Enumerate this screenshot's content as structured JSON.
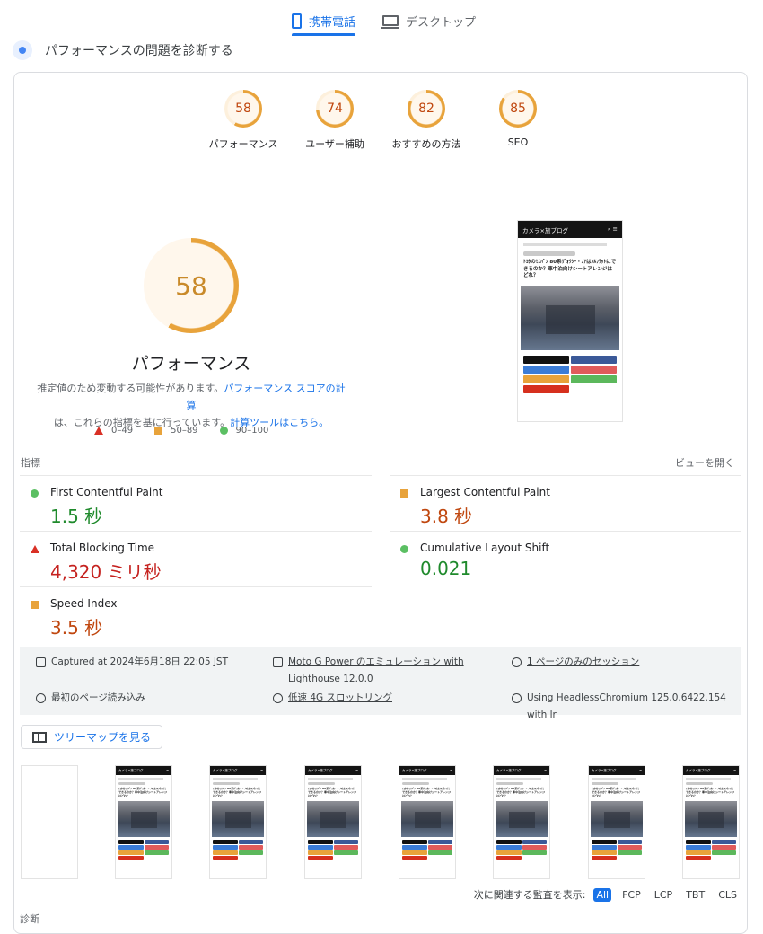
{
  "tabs": {
    "mobile": "携帯電話",
    "desktop": "デスクトップ"
  },
  "heading": "パフォーマンスの問題を診断する",
  "categories": [
    {
      "score": "58",
      "label": "パフォーマンス",
      "fill_pct": 58
    },
    {
      "score": "74",
      "label": "ユーザー補助",
      "fill_pct": 74
    },
    {
      "score": "82",
      "label": "おすすめの方法",
      "fill_pct": 82
    },
    {
      "score": "85",
      "label": "SEO",
      "fill_pct": 85
    }
  ],
  "performance": {
    "score": "58",
    "title": "パフォーマンス",
    "estimate_text_1": "推定値のため変動する可能性があります。",
    "estimate_link_1": "パフォーマンス スコアの計算",
    "estimate_text_2": "は、これらの指標を基に行っています。",
    "estimate_link_2": "計算ツールはこちら。"
  },
  "legend": {
    "fail": "0–49",
    "average": "50–89",
    "pass": "90–100"
  },
  "screenshot": {
    "site_title": "カメラ×旅ブログ",
    "article_title": "ﾄﾖﾀのﾐﾆﾊﾞﾝ 80系ｳﾞｫｸｼｰ・ﾉｱはﾌﾙﾌﾗｯﾄにできるのか？車中泊向けシートアレンジはどれ？",
    "share_labels": [
      "Post",
      "Share",
      "Hatena",
      "Pocket",
      "LINE",
      "Feedly",
      "ｺﾋﾟｰ"
    ]
  },
  "metrics": {
    "header": "指標",
    "expand": "ビューを開く",
    "fcp": {
      "name": "First Contentful Paint",
      "value": "1.5 秒"
    },
    "lcp": {
      "name": "Largest Contentful Paint",
      "value": "3.8 秒"
    },
    "tbt": {
      "name": "Total Blocking Time",
      "value": "4,320 ミリ秒"
    },
    "cls": {
      "name": "Cumulative Layout Shift",
      "value": "0.021"
    },
    "si": {
      "name": "Speed Index",
      "value": "3.5 秒"
    }
  },
  "info": {
    "captured": "Captured at 2024年6月18日 22:05 JST",
    "device_1": "Moto G Power のエミュレーション with",
    "device_2": "Lighthouse 12.0.0",
    "session": "1 ページのみのセッション",
    "load": "最初のページ読み込み",
    "throttle": "低速 4G スロットリング",
    "browser": "Using HeadlessChromium 125.0.6422.154 with lr"
  },
  "treemap_button": "ツリーマップを見る",
  "filters": {
    "label": "次に関連する監査を表示:",
    "all": "All",
    "fcp": "FCP",
    "lcp": "LCP",
    "tbt": "TBT",
    "cls": "CLS"
  },
  "diagnostics_label": "診断"
}
